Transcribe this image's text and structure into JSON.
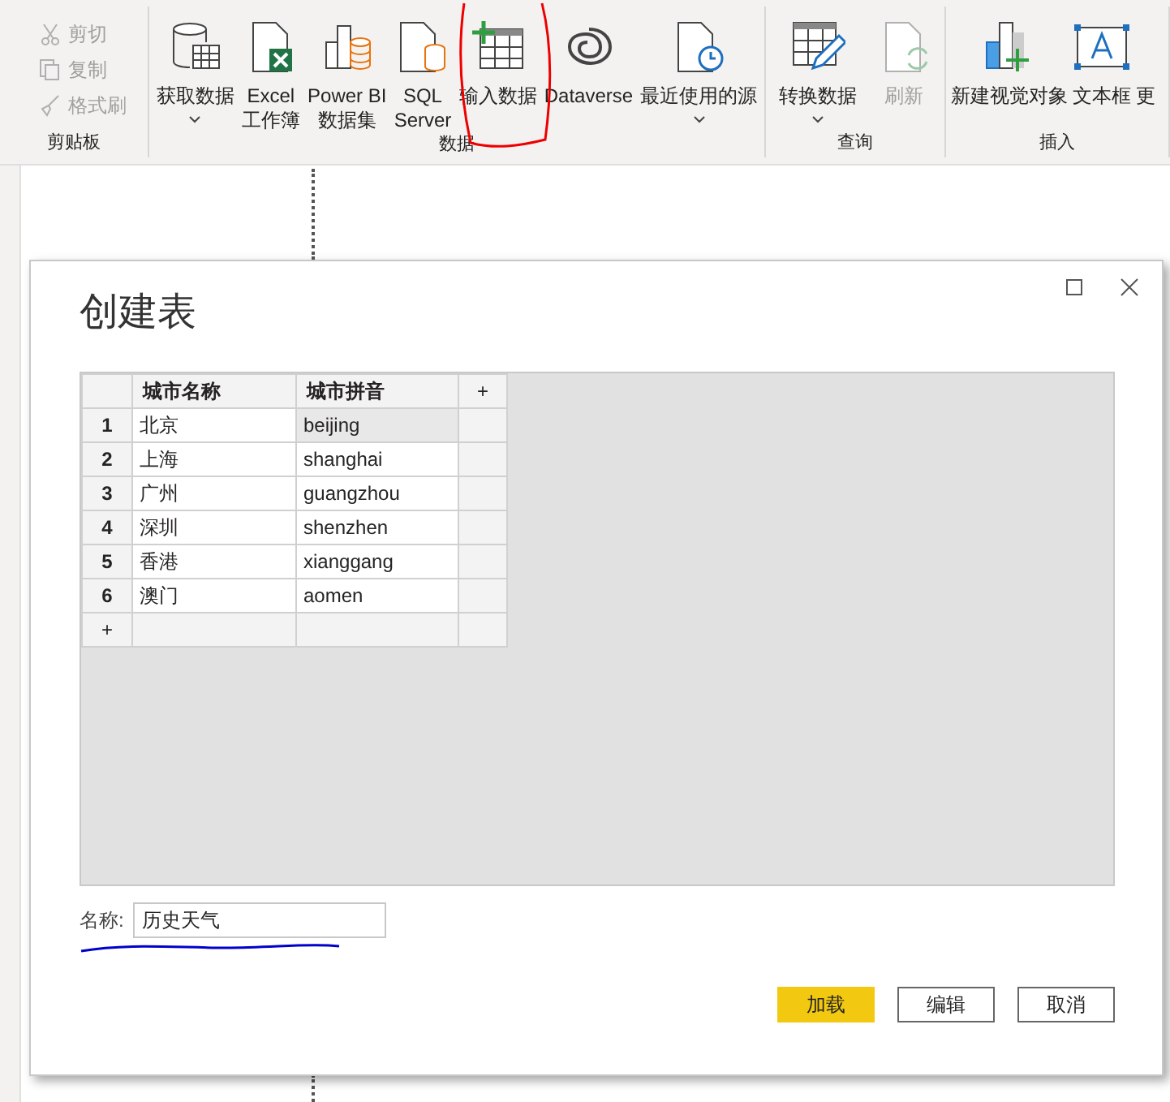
{
  "ribbon": {
    "groups": [
      {
        "label": "剪贴板",
        "items": [
          {
            "kind": "small",
            "lines": [
              "剪切"
            ],
            "disabled": true,
            "dropdown": false
          },
          {
            "kind": "small",
            "lines": [
              "复制"
            ],
            "disabled": true,
            "dropdown": false
          },
          {
            "kind": "small",
            "lines": [
              "格式刷"
            ],
            "disabled": true,
            "dropdown": false
          }
        ]
      },
      {
        "label": "数据",
        "items": [
          {
            "kind": "large",
            "lines": [
              "获取数据"
            ],
            "disabled": false,
            "dropdown": true
          },
          {
            "kind": "large",
            "lines": [
              "Excel",
              "工作簿"
            ],
            "disabled": false,
            "dropdown": false
          },
          {
            "kind": "large",
            "lines": [
              "Power BI",
              "数据集"
            ],
            "disabled": false,
            "dropdown": false
          },
          {
            "kind": "large",
            "lines": [
              "SQL",
              "Server"
            ],
            "disabled": false,
            "dropdown": false
          },
          {
            "kind": "large",
            "lines": [
              "输入数据"
            ],
            "disabled": false,
            "dropdown": false
          },
          {
            "kind": "large",
            "lines": [
              "Dataverse"
            ],
            "disabled": false,
            "dropdown": false
          },
          {
            "kind": "large",
            "lines": [
              "最近使用的源"
            ],
            "disabled": false,
            "dropdown": true
          }
        ]
      },
      {
        "label": "查询",
        "items": [
          {
            "kind": "large",
            "lines": [
              "转换数据"
            ],
            "disabled": false,
            "dropdown": true
          },
          {
            "kind": "large",
            "lines": [
              "刷新"
            ],
            "disabled": true,
            "dropdown": false
          }
        ]
      },
      {
        "label": "插入",
        "items": [
          {
            "kind": "large",
            "lines": [
              "新建视觉对象"
            ],
            "disabled": false,
            "dropdown": false
          },
          {
            "kind": "large",
            "lines": [
              "文本框"
            ],
            "disabled": false,
            "dropdown": false
          },
          {
            "kind": "large",
            "lines": [
              "更"
            ],
            "disabled": false,
            "dropdown": false
          }
        ]
      }
    ]
  },
  "dialog": {
    "title": "创建表",
    "table": {
      "columns": [
        "城市名称",
        "城市拼音"
      ],
      "add_column": "+",
      "add_row": "+",
      "rows": [
        {
          "number": "1",
          "cells": [
            {
              "text": "北京",
              "selected": false
            },
            {
              "text": "beijing",
              "selected": true
            }
          ]
        },
        {
          "number": "2",
          "cells": [
            {
              "text": "上海",
              "selected": false
            },
            {
              "text": "shanghai",
              "selected": false
            }
          ]
        },
        {
          "number": "3",
          "cells": [
            {
              "text": "广州",
              "selected": false
            },
            {
              "text": "guangzhou",
              "selected": false
            }
          ]
        },
        {
          "number": "4",
          "cells": [
            {
              "text": "深圳",
              "selected": false
            },
            {
              "text": "shenzhen",
              "selected": false
            }
          ]
        },
        {
          "number": "5",
          "cells": [
            {
              "text": "香港",
              "selected": false
            },
            {
              "text": "xianggang",
              "selected": false
            }
          ]
        },
        {
          "number": "6",
          "cells": [
            {
              "text": "澳门",
              "selected": false
            },
            {
              "text": "aomen",
              "selected": false
            }
          ]
        }
      ]
    },
    "name_label": "名称:",
    "name_value": "历史天气",
    "buttons": [
      {
        "label": "加载",
        "kind": "primary"
      },
      {
        "label": "编辑",
        "kind": "secondary"
      },
      {
        "label": "取消",
        "kind": "secondary"
      }
    ]
  }
}
